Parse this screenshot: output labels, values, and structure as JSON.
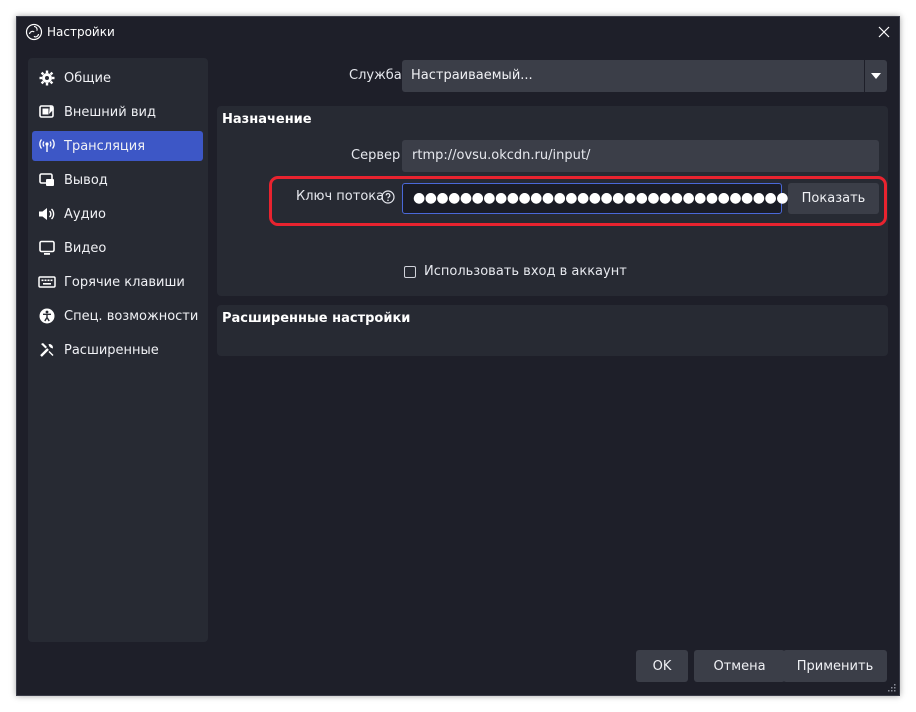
{
  "window": {
    "title": "Настройки"
  },
  "sidebar": {
    "items": [
      {
        "label": "Общие",
        "icon": "gear-icon",
        "active": false
      },
      {
        "label": "Внешний вид",
        "icon": "appearance-icon",
        "active": false
      },
      {
        "label": "Трансляция",
        "icon": "broadcast-icon",
        "active": true
      },
      {
        "label": "Вывод",
        "icon": "output-icon",
        "active": false
      },
      {
        "label": "Аудио",
        "icon": "speaker-icon",
        "active": false
      },
      {
        "label": "Видео",
        "icon": "monitor-icon",
        "active": false
      },
      {
        "label": "Горячие клавиши",
        "icon": "keyboard-icon",
        "active": false
      },
      {
        "label": "Спец. возможности",
        "icon": "accessibility-icon",
        "active": false
      },
      {
        "label": "Расширенные",
        "icon": "tools-icon",
        "active": false
      }
    ]
  },
  "main": {
    "service_label": "Служба",
    "service_value": "Настраиваемый...",
    "destination": {
      "title": "Назначение",
      "server_label": "Сервер",
      "server_value": "rtmp://ovsu.okcdn.ru/input/",
      "stream_key_label": "Ключ потока",
      "stream_key_masked": "●●●●●●●●●●●●●●●●●●●●●●●●●●●●●●●●●●●●●",
      "show_button": "Показать",
      "use_account_label": "Использовать вход в аккаунт",
      "use_account_checked": false
    },
    "advanced": {
      "title": "Расширенные настройки"
    }
  },
  "footer": {
    "ok": "OK",
    "cancel": "Отмена",
    "apply": "Применить"
  },
  "colors": {
    "window_bg": "#1e1f29",
    "panel_bg": "#272a33",
    "accent": "#3d57c6",
    "highlight": "#e8232f"
  }
}
